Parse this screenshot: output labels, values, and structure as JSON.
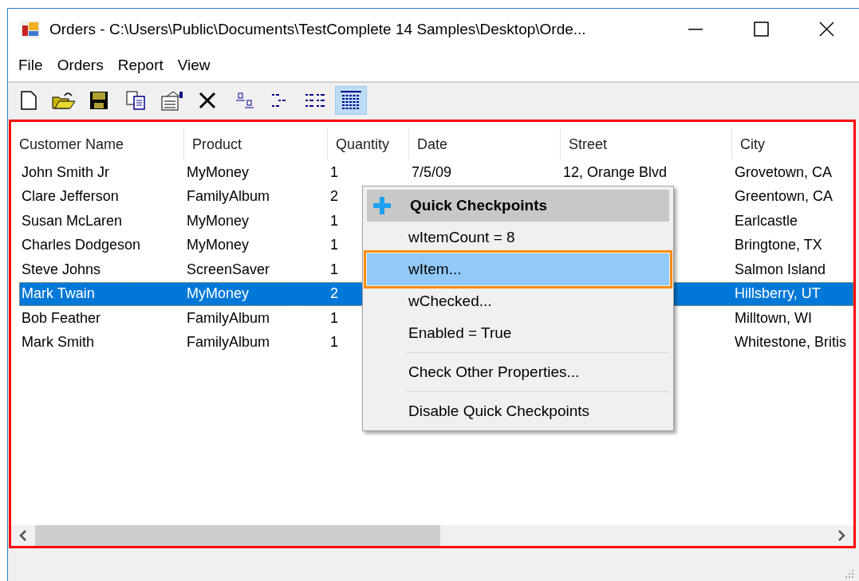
{
  "window": {
    "title": "Orders - C:\\Users\\Public\\Documents\\TestComplete 14 Samples\\Desktop\\Orde..."
  },
  "menu_bar": [
    "File",
    "Orders",
    "Report",
    "View"
  ],
  "toolbar": [
    {
      "kind": "new",
      "selected": false
    },
    {
      "kind": "open",
      "selected": false
    },
    {
      "kind": "save",
      "selected": false
    },
    {
      "kind": "copy",
      "selected": false
    },
    {
      "kind": "properties",
      "selected": false
    },
    {
      "kind": "delete",
      "selected": false
    },
    {
      "kind": "large",
      "selected": false
    },
    {
      "kind": "small",
      "selected": false
    },
    {
      "kind": "list",
      "selected": false
    },
    {
      "kind": "details",
      "selected": true
    }
  ],
  "table": {
    "columns": [
      "Customer Name",
      "Product",
      "Quantity",
      "Date",
      "Street",
      "City"
    ],
    "rows": [
      {
        "customer_name": "John Smith Jr",
        "product": "MyMoney",
        "quantity": "1",
        "date": "7/5/09",
        "street": "12, Orange Blvd",
        "city": "Grovetown, CA",
        "selected": false
      },
      {
        "customer_name": "Clare Jefferson",
        "product": "FamilyAlbum",
        "quantity": "2",
        "city": "Greentown, CA",
        "selected": false
      },
      {
        "customer_name": "Susan McLaren",
        "product": "MyMoney",
        "quantity": "1",
        "city": "Earlcastle",
        "selected": false
      },
      {
        "customer_name": "Charles Dodgeson",
        "product": "MyMoney",
        "quantity": "1",
        "city": "Bringtone, TX",
        "selected": false
      },
      {
        "customer_name": "Steve Johns",
        "product": "ScreenSaver",
        "quantity": "1",
        "city": "Salmon Island",
        "selected": false
      },
      {
        "customer_name": "Mark Twain",
        "product": "MyMoney",
        "quantity": "2",
        "city": "Hillsberry, UT",
        "selected": true
      },
      {
        "customer_name": "Bob Feather",
        "product": "FamilyAlbum",
        "quantity": "1",
        "city": "Milltown, WI",
        "selected": false
      },
      {
        "customer_name": "Mark Smith",
        "product": "FamilyAlbum",
        "quantity": "1",
        "city": "Whitestone, Britis",
        "selected": false
      }
    ]
  },
  "context_menu": {
    "title": "Quick Checkpoints",
    "groups": [
      [
        {
          "label": "wItemCount = 8",
          "selected": false
        },
        {
          "label": "wItem...",
          "selected": true
        },
        {
          "label": "wChecked...",
          "selected": false
        },
        {
          "label": "Enabled = True",
          "selected": false
        }
      ],
      [
        {
          "label": "Check Other Properties...",
          "selected": false
        }
      ],
      [
        {
          "label": "Disable Quick Checkpoints",
          "selected": false
        }
      ]
    ]
  }
}
